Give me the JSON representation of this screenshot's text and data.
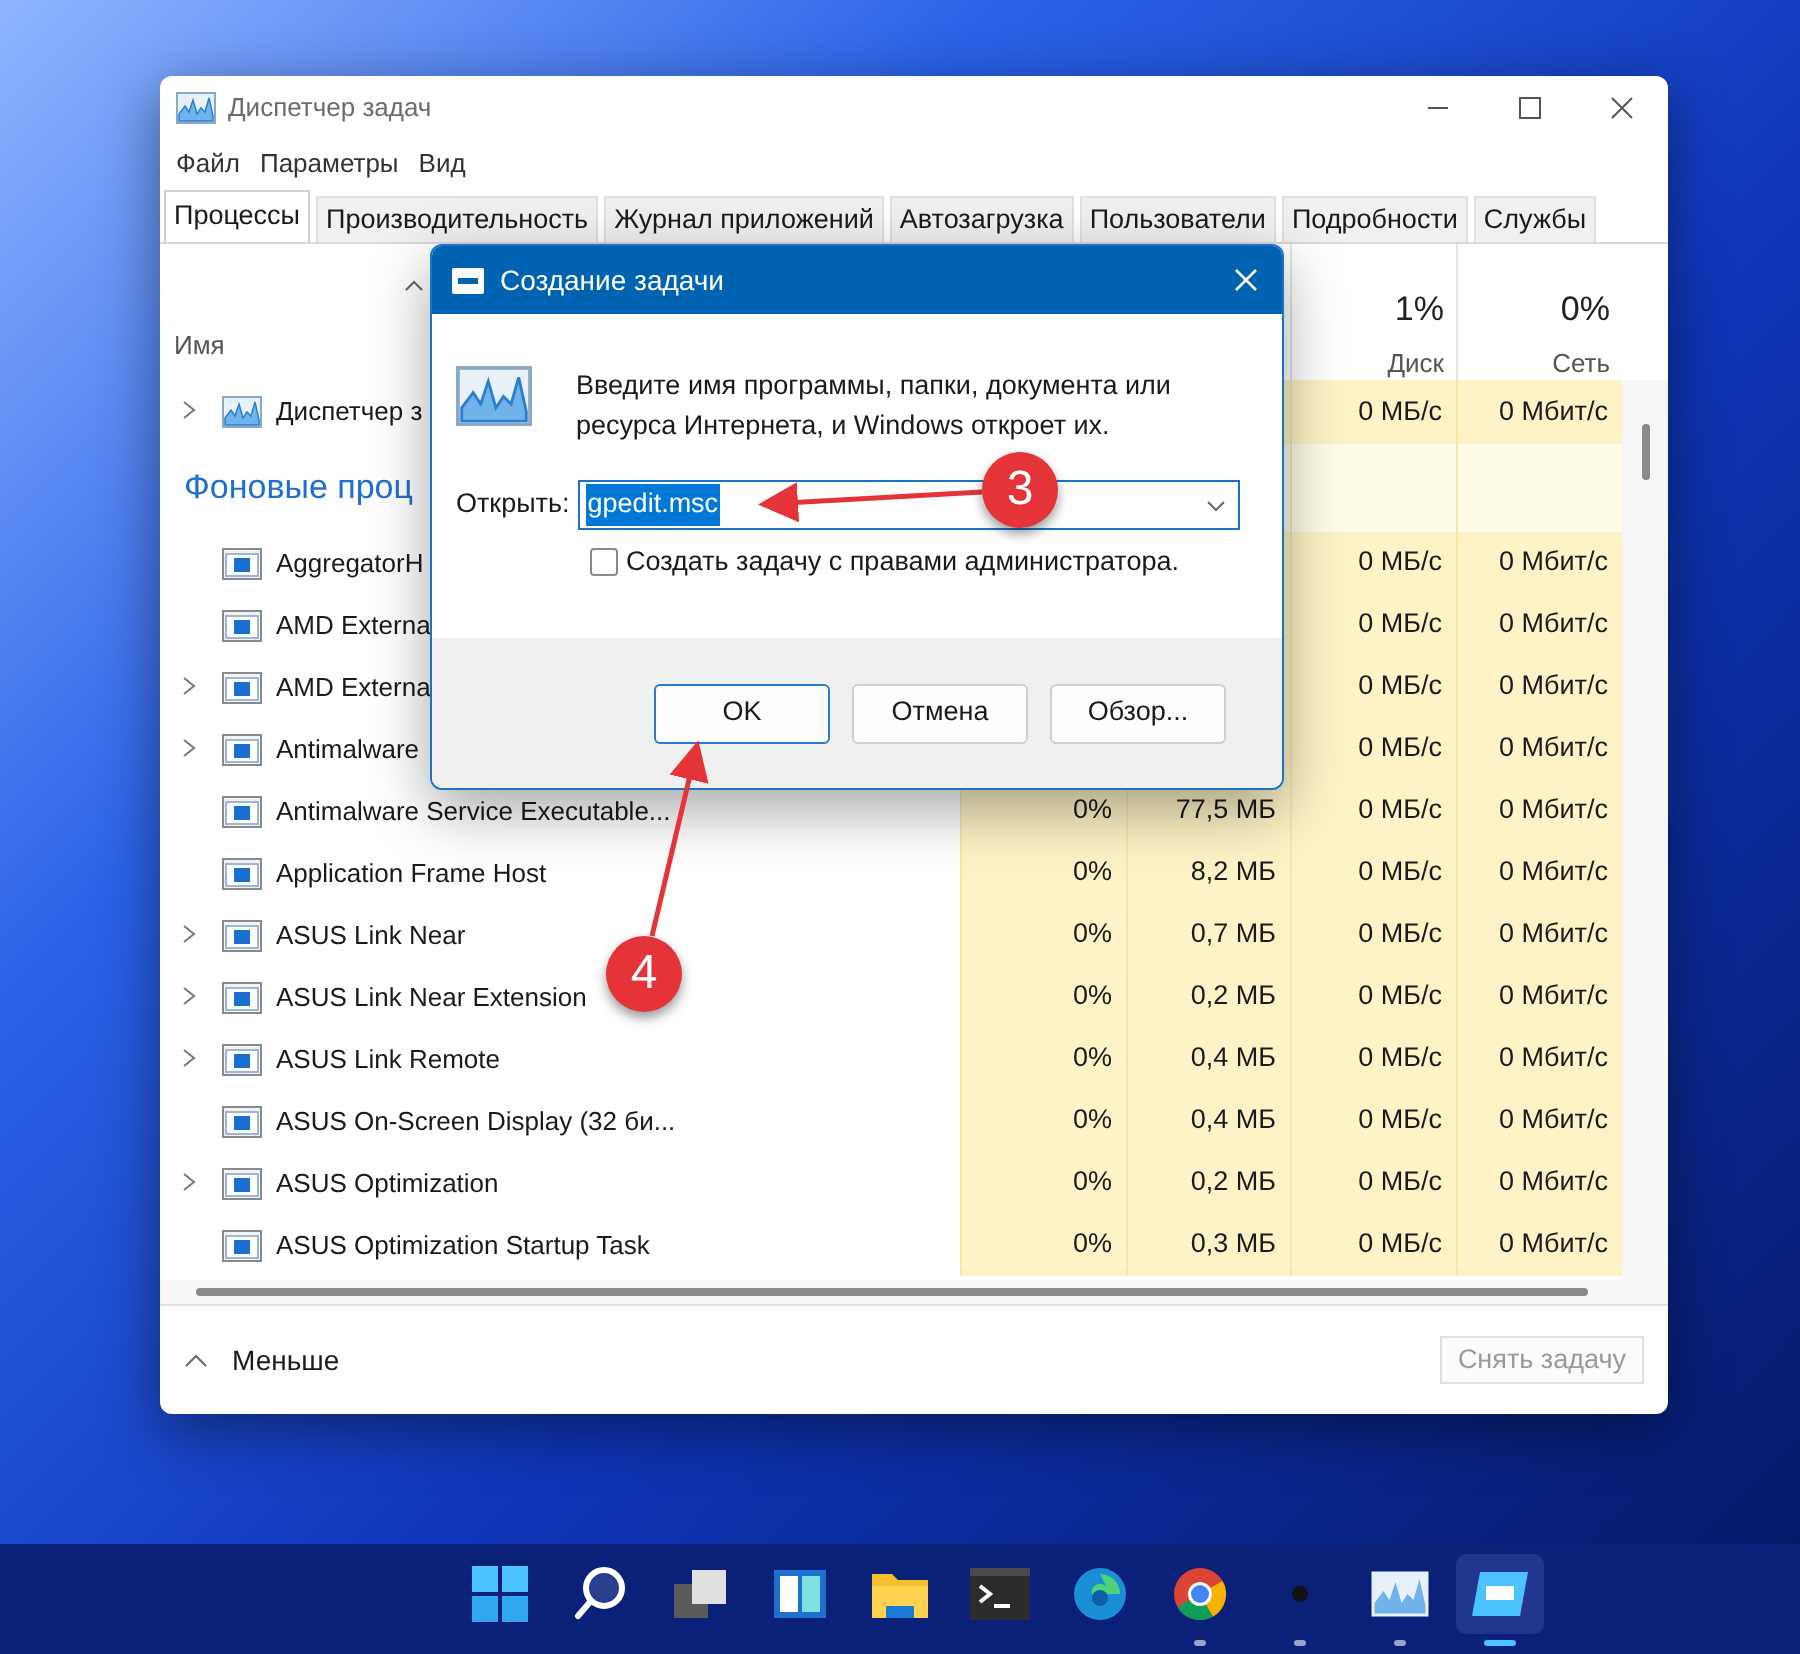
{
  "window": {
    "title": "Диспетчер задач"
  },
  "menu": [
    "Файл",
    "Параметры",
    "Вид"
  ],
  "tabs": [
    {
      "label": "Процессы",
      "selected": true
    },
    {
      "label": "Производительность",
      "selected": false
    },
    {
      "label": "Журнал приложений",
      "selected": false
    },
    {
      "label": "Автозагрузка",
      "selected": false
    },
    {
      "label": "Пользователи",
      "selected": false
    },
    {
      "label": "Подробности",
      "selected": false
    },
    {
      "label": "Службы",
      "selected": false
    }
  ],
  "table": {
    "name_header": "Имя",
    "columns": [
      {
        "usage": "1%",
        "label": "Диск"
      },
      {
        "usage": "0%",
        "label": "Сеть"
      }
    ],
    "rows": [
      {
        "kind": "app",
        "name": "Диспетчер з",
        "expandable": true,
        "disk": "0 МБ/с",
        "network": "0 Мбит/с"
      },
      {
        "kind": "group",
        "name": "Фоновые проц"
      },
      {
        "kind": "process",
        "name": "AggregatorH",
        "expandable": false,
        "disk": "0 МБ/с",
        "network": "0 Мбит/с"
      },
      {
        "kind": "process",
        "name": "AMD Externa",
        "expandable": false,
        "disk": "0 МБ/с",
        "network": "0 Мбит/с"
      },
      {
        "kind": "process",
        "name": "AMD Externa",
        "expandable": true,
        "disk": "0 МБ/с",
        "network": "0 Мбит/с"
      },
      {
        "kind": "process",
        "name": "Antimalware",
        "expandable": true,
        "disk": "0 МБ/с",
        "network": "0 Мбит/с"
      },
      {
        "kind": "process",
        "name": "Antimalware Service Executable...",
        "expandable": false,
        "cpu": "0%",
        "memory": "77,5 МБ",
        "disk": "0 МБ/с",
        "network": "0 Мбит/с"
      },
      {
        "kind": "process",
        "name": "Application Frame Host",
        "expandable": false,
        "cpu": "0%",
        "memory": "8,2 МБ",
        "disk": "0 МБ/с",
        "network": "0 Мбит/с"
      },
      {
        "kind": "process",
        "name": "ASUS Link Near",
        "expandable": true,
        "cpu": "0%",
        "memory": "0,7 МБ",
        "disk": "0 МБ/с",
        "network": "0 Мбит/с"
      },
      {
        "kind": "process",
        "name": "ASUS Link Near Extension",
        "expandable": true,
        "cpu": "0%",
        "memory": "0,2 МБ",
        "disk": "0 МБ/с",
        "network": "0 Мбит/с"
      },
      {
        "kind": "process",
        "name": "ASUS Link Remote",
        "expandable": true,
        "cpu": "0%",
        "memory": "0,4 МБ",
        "disk": "0 МБ/с",
        "network": "0 Мбит/с"
      },
      {
        "kind": "process",
        "name": "ASUS On-Screen Display (32 би...",
        "expandable": false,
        "cpu": "0%",
        "memory": "0,4 МБ",
        "disk": "0 МБ/с",
        "network": "0 Мбит/с"
      },
      {
        "kind": "process",
        "name": "ASUS Optimization",
        "expandable": true,
        "cpu": "0%",
        "memory": "0,2 МБ",
        "disk": "0 МБ/с",
        "network": "0 Мбит/с"
      },
      {
        "kind": "process",
        "name": "ASUS Optimization Startup Task",
        "expandable": false,
        "cpu": "0%",
        "memory": "0,3 МБ",
        "disk": "0 МБ/с",
        "network": "0 Мбит/с"
      }
    ]
  },
  "footer": {
    "toggle": "Меньше",
    "end_task": {
      "label": "Снять задачу",
      "disabled": true
    }
  },
  "dialog": {
    "title": "Создание задачи",
    "message": "Введите имя программы, папки, документа или ресурса Интернета, и Windows откроет их.",
    "open_label": "Открыть:",
    "open_value": "gpedit.msc",
    "admin_checkbox": {
      "label": "Создать задачу с правами администратора.",
      "checked": false
    },
    "buttons": [
      {
        "label": "OK",
        "default": true
      },
      {
        "label": "Отмена",
        "default": false
      },
      {
        "label": "Обзор...",
        "default": false
      }
    ]
  },
  "annotations": [
    {
      "number": "3"
    },
    {
      "number": "4"
    }
  ],
  "taskbar": [
    {
      "kind": "start",
      "running": false,
      "selected": false
    },
    {
      "kind": "search",
      "running": false,
      "selected": false
    },
    {
      "kind": "taskview",
      "running": false,
      "selected": false
    },
    {
      "kind": "widgets",
      "running": false,
      "selected": false
    },
    {
      "kind": "folder",
      "running": false,
      "selected": false
    },
    {
      "kind": "terminal",
      "running": false,
      "selected": false
    },
    {
      "kind": "edge",
      "running": false,
      "selected": false
    },
    {
      "kind": "chrome",
      "running": true,
      "selected": false
    },
    {
      "kind": "dot",
      "running": true,
      "selected": false
    },
    {
      "kind": "graph",
      "running": true,
      "selected": false
    },
    {
      "kind": "dialog",
      "running": true,
      "selected": true
    }
  ]
}
